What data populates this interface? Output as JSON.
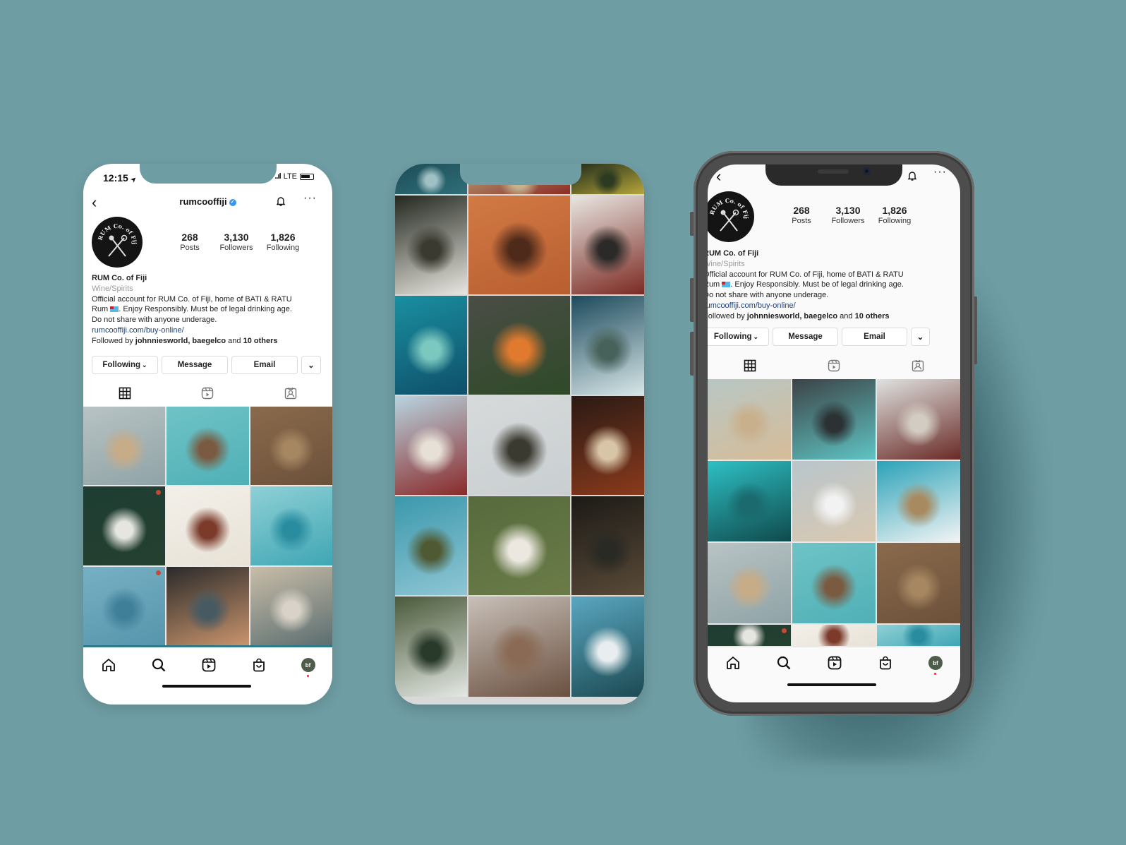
{
  "profile": {
    "username": "rumcooffiji",
    "verified": true,
    "stats": [
      {
        "value": "268",
        "label": "Posts"
      },
      {
        "value": "3,130",
        "label": "Followers"
      },
      {
        "value": "1,826",
        "label": "Following"
      }
    ],
    "name": "RUM Co. of Fiji",
    "category": "Wine/Spirits",
    "bio_line1": "Official account for RUM Co. of Fiji, home of BATI & RATU",
    "bio_line2_pre": "Rum ",
    "bio_line2_post": ". Enjoy Responsibly. Must be of legal drinking age.",
    "bio_line3": "Do not share with anyone underage.",
    "link": "rumcooffiji.com/buy-online/",
    "followed_by_prefix": "Followed by ",
    "followed_by_names": "johnniesworld, baegelco",
    "followed_by_and": " and ",
    "followed_by_others": "10 others",
    "avatar_logo_text": "RUM Co. of Fiji"
  },
  "buttons": {
    "following": "Following",
    "message": "Message",
    "email": "Email",
    "chevron": "⌄"
  },
  "icons": {
    "back": "‹",
    "more": "···",
    "verified": "✓",
    "dropdown": "⌄"
  },
  "status_bar": {
    "time": "12:15",
    "location_arrow": "➤",
    "network": "LTE",
    "signal": "..ıl"
  },
  "tabs": [
    "grid",
    "reels",
    "tagged"
  ],
  "bottom_nav": {
    "items": [
      "home",
      "search",
      "reels",
      "shop",
      "profile"
    ],
    "profile_initials": "bf"
  },
  "colors": {
    "background": "#6e9da3",
    "link": "#1f3f78",
    "verified": "#3897f0",
    "notification_dot": "#ff2040",
    "profile_avatar": "#4f5c4b"
  },
  "phone1_grid": [
    {
      "desc": "bottle on post by beach",
      "colors": [
        "#b8c3c4",
        "#8fa3a6",
        "#c7ac88"
      ],
      "badge": false
    },
    {
      "desc": "palm tree teal sky",
      "colors": [
        "#6fc3c6",
        "#4fb0b6",
        "#7a5a40"
      ],
      "badge": false
    },
    {
      "desc": "bottle on sand",
      "colors": [
        "#8a6a4c",
        "#6c513a",
        "#a68762"
      ],
      "badge": false
    },
    {
      "desc": "aerial surf and sea",
      "colors": [
        "#1e3d33",
        "#24402f",
        "#e6e6e0"
      ],
      "badge": true
    },
    {
      "desc": "RATU bottle close-up",
      "colors": [
        "#f3f0ea",
        "#e8e2d6",
        "#7b3a2a"
      ],
      "badge": false
    },
    {
      "desc": "island on turquoise sea",
      "colors": [
        "#8fd0d6",
        "#3fa6b4",
        "#2a8d9f"
      ],
      "badge": false
    },
    {
      "desc": "hand holding bottle at sea",
      "colors": [
        "#77b0c4",
        "#5695ac",
        "#3f7f98"
      ],
      "badge": true
    },
    {
      "desc": "palm silhouette sunset",
      "colors": [
        "#2a2a2a",
        "#c9946c",
        "#475a62"
      ],
      "badge": false
    },
    {
      "desc": "BATI bottle on boardwalk",
      "colors": [
        "#c9bda8",
        "#5b6e70",
        "#d8d2c8"
      ],
      "badge": false
    }
  ],
  "phone2_grid": [
    {
      "desc": "ocean water",
      "colors": [
        "#1d4d58",
        "#2f6e78",
        "#9fc0c4"
      ]
    },
    {
      "desc": "bottle label strip",
      "colors": [
        "#b7a27c",
        "#8c2d24",
        "#c6b28e"
      ]
    },
    {
      "desc": "palm leaves",
      "colors": [
        "#1e2a1a",
        "#b6a63a",
        "#2c3a22"
      ]
    },
    {
      "desc": "RATU bottles on ground",
      "colors": [
        "#23281f",
        "#e8e6e0",
        "#3a3a30"
      ]
    },
    {
      "desc": "orange sunset over sea",
      "colors": [
        "#d27a45",
        "#b85e30",
        "#4e2a1a"
      ]
    },
    {
      "desc": "hands holding RATU bottle",
      "colors": [
        "#e9e6e2",
        "#7b2a22",
        "#2c2a28"
      ]
    },
    {
      "desc": "aerial reef",
      "colors": [
        "#1a8fa0",
        "#0f4f6a",
        "#7bc8c0"
      ]
    },
    {
      "desc": "man with bottle and fire",
      "colors": [
        "#4a4d46",
        "#2f4a28",
        "#e07a2e"
      ]
    },
    {
      "desc": "coastline aerial",
      "colors": [
        "#1c4a5c",
        "#d7e6e8",
        "#47625a"
      ]
    },
    {
      "desc": "RATU bottle against sky",
      "colors": [
        "#b8d4e0",
        "#8a2a2a",
        "#e6e0d6"
      ]
    },
    {
      "desc": "palm tree grey sky",
      "colors": [
        "#d6dadb",
        "#c9ced0",
        "#3b3a30"
      ]
    },
    {
      "desc": "RATU bottle glow",
      "colors": [
        "#2a1a14",
        "#8a3a1c",
        "#d8c4a6"
      ]
    },
    {
      "desc": "cloud and mountain",
      "colors": [
        "#3b98ac",
        "#8fc6d4",
        "#4f5a34"
      ]
    },
    {
      "desc": "BATI bottle on grass",
      "colors": [
        "#566a3c",
        "#6b7c48",
        "#ece8e0"
      ]
    },
    {
      "desc": "barrel warehouse",
      "colors": [
        "#1c1a16",
        "#5a4a38",
        "#2a2a24"
      ]
    },
    {
      "desc": "bottle in sugarcane",
      "colors": [
        "#4a5a3a",
        "#e4e8e4",
        "#2a3a2a"
      ]
    },
    {
      "desc": "man on rock",
      "colors": [
        "#c8c0b8",
        "#6a5040",
        "#8a6a54"
      ]
    },
    {
      "desc": "sea and hills",
      "colors": [
        "#5aa6c0",
        "#1c4a52",
        "#e8eef0"
      ]
    }
  ],
  "phone3_grid": [
    {
      "desc": "bottle on beach sand",
      "colors": [
        "#b8c7c4",
        "#d6bc98",
        "#c9b08c"
      ],
      "badge": false
    },
    {
      "desc": "lava shoreline aerial",
      "colors": [
        "#3c4346",
        "#5fc4c4",
        "#2c3234"
      ],
      "badge": false
    },
    {
      "desc": "RATU bottle in surf",
      "colors": [
        "#dfe2e0",
        "#6a2a26",
        "#d2ccc2"
      ],
      "badge": false
    },
    {
      "desc": "surfer in barrel wave",
      "colors": [
        "#2ec0c4",
        "#0f4a4c",
        "#1a6a6e"
      ],
      "badge": false
    },
    {
      "desc": "BATI bottle on beach",
      "colors": [
        "#b9c6cc",
        "#d9c8b0",
        "#f2f2f2"
      ],
      "badge": false
    },
    {
      "desc": "clouds over island",
      "colors": [
        "#2ba2b8",
        "#f2f4f4",
        "#a88a60"
      ],
      "badge": false
    },
    {
      "desc": "bottle on post by beach",
      "colors": [
        "#b8c3c4",
        "#8fa3a6",
        "#c7ac88"
      ],
      "badge": false
    },
    {
      "desc": "palm tree teal sky",
      "colors": [
        "#6fc3c6",
        "#4fb0b6",
        "#7a5a40"
      ],
      "badge": false
    },
    {
      "desc": "bottle on sand",
      "colors": [
        "#8a6a4c",
        "#6c513a",
        "#a68762"
      ],
      "badge": false
    },
    {
      "desc": "aerial surf and sea",
      "colors": [
        "#1e3d33",
        "#24402f",
        "#e6e6e0"
      ],
      "badge": true
    },
    {
      "desc": "RATU bottle close-up",
      "colors": [
        "#f3f0ea",
        "#e8e2d6",
        "#7b3a2a"
      ],
      "badge": false
    },
    {
      "desc": "island on turquoise sea",
      "colors": [
        "#8fd0d6",
        "#3fa6b4",
        "#2a8d9f"
      ],
      "badge": false
    }
  ]
}
